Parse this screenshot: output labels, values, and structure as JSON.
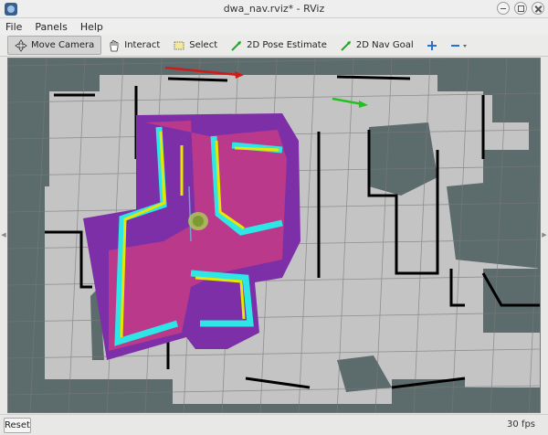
{
  "window": {
    "title": "dwa_nav.rviz* - RViz"
  },
  "menu": [
    {
      "label": "File",
      "accel": "F"
    },
    {
      "label": "Panels",
      "accel": "P"
    },
    {
      "label": "Help",
      "accel": "H"
    }
  ],
  "toolbar": {
    "move_camera": "Move Camera",
    "interact": "Interact",
    "select": "Select",
    "pose_estimate": "2D Pose Estimate",
    "nav_goal": "2D Nav Goal"
  },
  "status": {
    "reset": "Reset",
    "fps": "30 fps"
  },
  "colors": {
    "map_free": "#c4c4c4",
    "map_unknown": "#5c6b6b",
    "map_wall": "#000000",
    "costmap_purple": "#7d2fa8",
    "costmap_cyan": "#2ee6e6",
    "costmap_yellow": "#e6e600",
    "pose_arrow_red": "#d11a1a",
    "goal_arrow_green": "#21c21c"
  }
}
